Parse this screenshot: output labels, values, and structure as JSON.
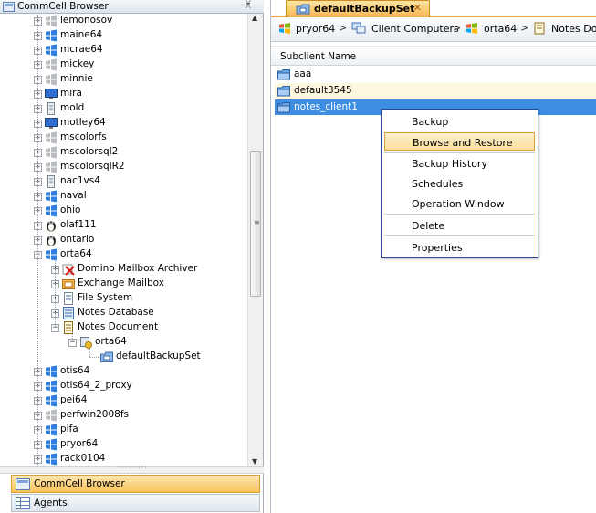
{
  "left": {
    "title": "CommCell Browser",
    "pin": "ᚸ",
    "tree": [
      {
        "label": "lemonosov",
        "icon": "client-icon-gray",
        "level": 0
      },
      {
        "label": "maine64",
        "icon": "windows-client-icon",
        "level": 0
      },
      {
        "label": "mcrae64",
        "icon": "windows-client-icon",
        "level": 0
      },
      {
        "label": "mickey",
        "icon": "client-icon-gray",
        "level": 0
      },
      {
        "label": "minnie",
        "icon": "client-icon-gray",
        "level": 0
      },
      {
        "label": "mira",
        "icon": "monitor-client-icon",
        "level": 0
      },
      {
        "label": "mold",
        "icon": "server-client-icon",
        "level": 0
      },
      {
        "label": "motley64",
        "icon": "monitor-client-icon",
        "level": 0
      },
      {
        "label": "mscolorfs",
        "icon": "client-icon-gray",
        "level": 0
      },
      {
        "label": "mscolorsql2",
        "icon": "client-icon-gray",
        "level": 0
      },
      {
        "label": "mscolorsqlR2",
        "icon": "client-icon-gray",
        "level": 0
      },
      {
        "label": "nac1vs4",
        "icon": "server-client-icon",
        "level": 0
      },
      {
        "label": "naval",
        "icon": "windows-client-icon",
        "level": 0
      },
      {
        "label": "ohio",
        "icon": "windows-client-icon",
        "level": 0
      },
      {
        "label": "olaf111",
        "icon": "linux-client-icon",
        "level": 0
      },
      {
        "label": "ontario",
        "icon": "linux-client-icon",
        "level": 0
      },
      {
        "label": "orta64",
        "icon": "windows-client-icon",
        "level": 0,
        "expanded": true
      },
      {
        "label": "Domino Mailbox Archiver",
        "icon": "domino-archiver-icon",
        "level": 1
      },
      {
        "label": "Exchange Mailbox",
        "icon": "exchange-mailbox-icon",
        "level": 1
      },
      {
        "label": "File System",
        "icon": "file-system-icon",
        "level": 1
      },
      {
        "label": "Notes Database",
        "icon": "notes-database-icon",
        "level": 1
      },
      {
        "label": "Notes Document",
        "icon": "notes-document-icon",
        "level": 1,
        "expanded": true
      },
      {
        "label": "orta64",
        "icon": "instance-icon",
        "level": 2,
        "expanded": true
      },
      {
        "label": "defaultBackupSet",
        "icon": "backupset-icon",
        "level": 3
      },
      {
        "label": "otis64",
        "icon": "windows-client-icon",
        "level": 0
      },
      {
        "label": "otis64_2_proxy",
        "icon": "windows-client-icon",
        "level": 0
      },
      {
        "label": "pei64",
        "icon": "windows-client-icon",
        "level": 0
      },
      {
        "label": "perfwin2008fs",
        "icon": "client-icon-gray",
        "level": 0
      },
      {
        "label": "pifa",
        "icon": "windows-client-icon",
        "level": 0
      },
      {
        "label": "pryor64",
        "icon": "windows-client-icon",
        "level": 0
      },
      {
        "label": "rack0104",
        "icon": "windows-client-icon",
        "level": 0
      }
    ],
    "bottom_tabs": [
      {
        "label": "CommCell Browser",
        "active": true
      },
      {
        "label": "Agents",
        "active": false
      }
    ]
  },
  "right": {
    "tab": {
      "label": "defaultBackupSet",
      "close": "✕"
    },
    "breadcrumb": [
      {
        "label": "pryor64"
      },
      {
        "label": "Client Computers"
      },
      {
        "label": "orta64"
      },
      {
        "label": "Notes Doc"
      }
    ],
    "breadcrumb_sep": ">",
    "grid": {
      "header": "Subclient Name",
      "rows": [
        {
          "label": "aaa",
          "style": "normal"
        },
        {
          "label": "default3545",
          "style": "alt"
        },
        {
          "label": "notes_client1",
          "style": "selected"
        }
      ]
    },
    "context_menu": [
      {
        "label": "Backup"
      },
      {
        "label": "Browse and Restore",
        "hover": true
      },
      {
        "label": "Backup History"
      },
      {
        "label": "Schedules"
      },
      {
        "label": "Operation Window"
      },
      {
        "label": "Delete"
      },
      {
        "label": "Properties"
      }
    ]
  },
  "colors": {
    "accent": "#f7b54a",
    "selection": "#3d8ee3",
    "menu_border": "#2b4b95"
  }
}
